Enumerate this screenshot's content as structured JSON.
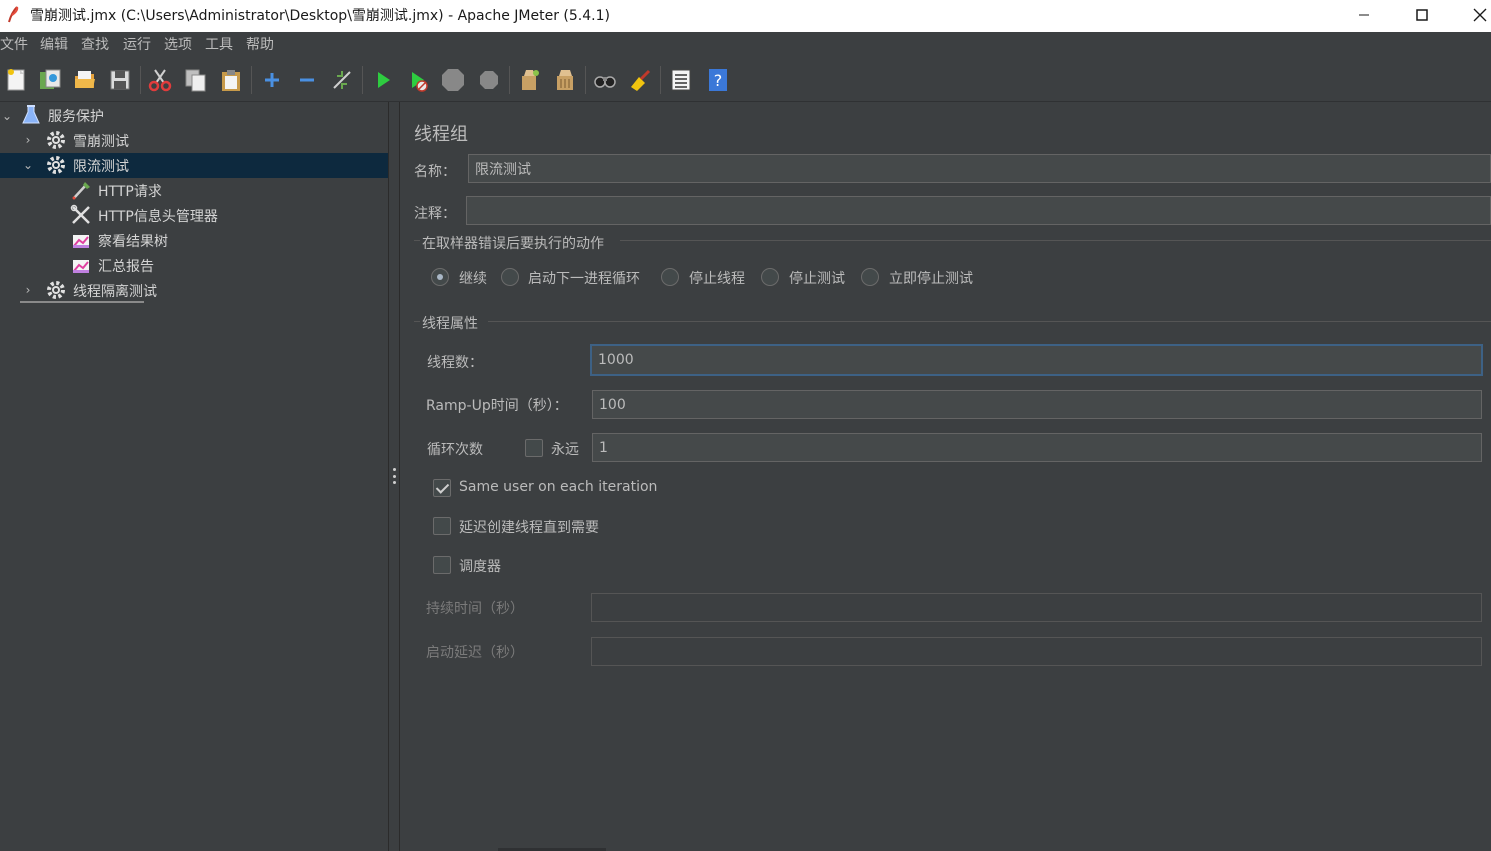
{
  "window": {
    "title": "雪崩测试.jmx (C:\\Users\\Administrator\\Desktop\\雪崩测试.jmx) - Apache JMeter (5.4.1)",
    "controls": [
      "minimize",
      "maximize",
      "close"
    ]
  },
  "menu": [
    "文件",
    "编辑",
    "查找",
    "运行",
    "选项",
    "工具",
    "帮助"
  ],
  "toolbar": [
    "new-icon",
    "templates-icon",
    "open-icon",
    "save-icon",
    "cut-icon",
    "copy-icon",
    "paste-icon",
    "expand-icon",
    "collapse-icon",
    "toggle-icon",
    "start-icon",
    "start-no-pause-icon",
    "stop-icon",
    "shutdown-icon",
    "clear-icon",
    "clear-all-icon",
    "search-icon",
    "reset-search-icon",
    "function-helper-icon",
    "help-icon"
  ],
  "tree": {
    "root": "服务保护",
    "items": [
      {
        "label": "雪崩测试",
        "expanded": false
      },
      {
        "label": "限流测试",
        "expanded": true,
        "selected": true,
        "children": [
          "HTTP请求",
          "HTTP信息头管理器",
          "察看结果树",
          "汇总报告"
        ]
      },
      {
        "label": "线程隔离测试",
        "expanded": false
      }
    ]
  },
  "panel": {
    "title": "线程组",
    "name_label": "名称：",
    "name_value": "限流测试",
    "comment_label": "注释：",
    "comment_value": "",
    "error_section": "在取样器错误后要执行的动作",
    "error_options": [
      "继续",
      "启动下一进程循环",
      "停止线程",
      "停止测试",
      "立即停止测试"
    ],
    "error_selected": "继续",
    "thread_section": "线程属性",
    "threads_label": "线程数：",
    "threads_value": "1000",
    "rampup_label": "Ramp-Up时间（秒）：",
    "rampup_value": "100",
    "loop_label": "循环次数",
    "forever_label": "永远",
    "forever_checked": false,
    "loop_value": "1",
    "same_user_label": "Same user on each iteration",
    "same_user_checked": true,
    "delay_label": "延迟创建线程直到需要",
    "delay_checked": false,
    "scheduler_label": "调度器",
    "scheduler_checked": false,
    "duration_label": "持续时间（秒）",
    "duration_value": "",
    "startup_label": "启动延迟（秒）",
    "startup_value": ""
  },
  "colors": {
    "background": "#3c3f41",
    "selection": "#0d293e",
    "focus_border": "#3d6185",
    "field_bg": "#45494a"
  }
}
